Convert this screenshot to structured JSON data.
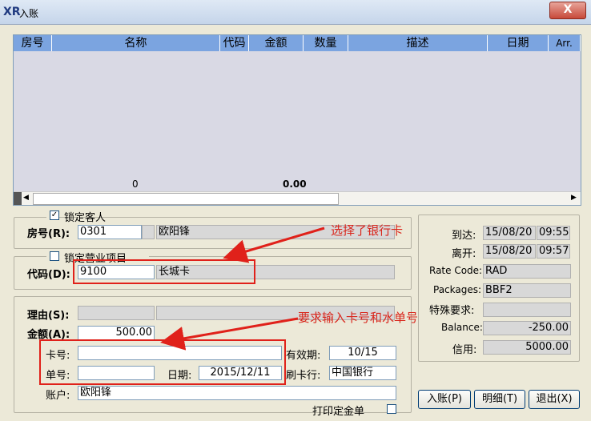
{
  "window": {
    "title": "入账",
    "close_label": "X"
  },
  "grid": {
    "columns": [
      "房号",
      "名称",
      "代码",
      "金额",
      "数量",
      "描述",
      "日期",
      "Arr."
    ],
    "footer_count": "0",
    "footer_amount": "0.00"
  },
  "lock_guest": {
    "label": "锁定客人",
    "checked": "✓"
  },
  "room": {
    "label": "房号(R):",
    "value": "0301",
    "name": "欧阳锋"
  },
  "lock_item": {
    "label": "锁定营业项目"
  },
  "code": {
    "label": "代码(D):",
    "value": "9100",
    "desc": "长城卡"
  },
  "reason": {
    "label": "理由(S):"
  },
  "amount": {
    "label": "金额(A):",
    "value": "500.00"
  },
  "card_no": {
    "label": "卡号:",
    "value": ""
  },
  "expiry": {
    "label": "有效期:",
    "value": "10/15"
  },
  "slip_no": {
    "label": "单号:",
    "value": ""
  },
  "date": {
    "label": "日期:",
    "value": "2015/12/11"
  },
  "bank": {
    "label": "刷卡行:",
    "value": "中国银行"
  },
  "account": {
    "label": "账户:",
    "value": "欧阳锋"
  },
  "print_slip": {
    "label": "打印定金单"
  },
  "info": {
    "arrive_label": "到达:",
    "arrive_date": "15/08/20",
    "arrive_time": "09:55",
    "depart_label": "离开:",
    "depart_date": "15/08/20",
    "depart_time": "09:57",
    "rate_label": "Rate Code:",
    "rate_value": "RAD",
    "pkg_label": "Packages:",
    "pkg_value": "BBF2",
    "special_label": "特殊要求:",
    "special_value": "",
    "balance_label": "Balance:",
    "balance_value": "-250.00",
    "credit_label": "信用:",
    "credit_value": "5000.00"
  },
  "buttons": {
    "post": "入账(P)",
    "detail": "明细(T)",
    "exit": "退出(X)"
  },
  "annotations": {
    "bank_card": "选择了银行卡",
    "require_input": "要求输入卡号和水单号"
  }
}
